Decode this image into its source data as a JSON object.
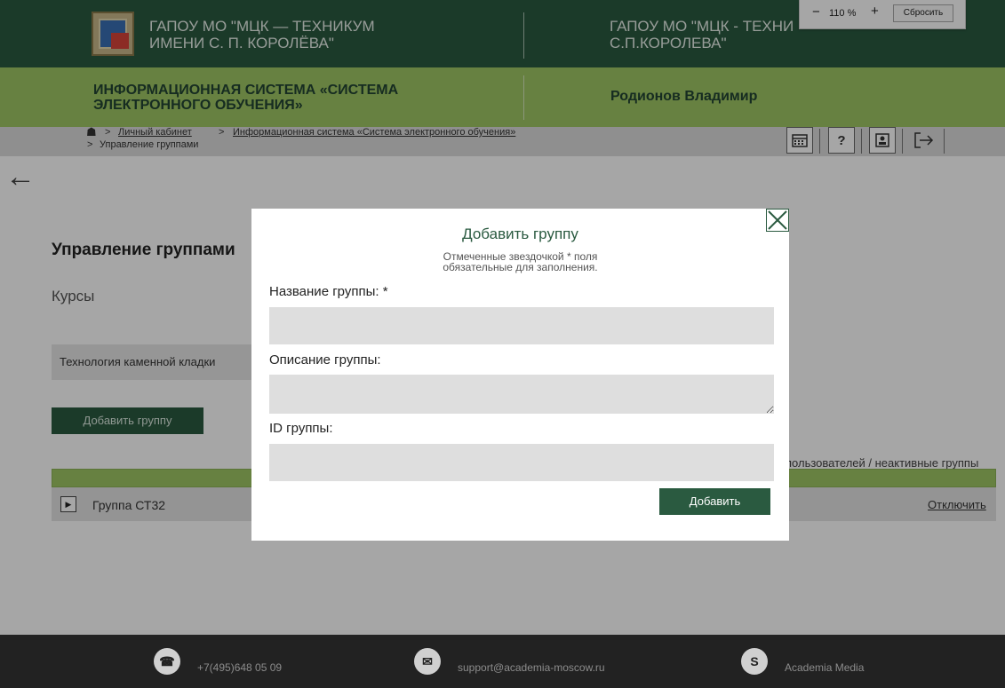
{
  "header": {
    "org_name_line1": "ГАПОУ МО \"МЦК — ТЕХНИКУМ",
    "org_name_line2": "ИМЕНИ С. П. КОРОЛЁВА\"",
    "org_name_alt_line1": "ГАПОУ МО \"МЦК - ТЕХНИ",
    "org_name_alt_line2": "С.П.КОРОЛЕВА\"",
    "system_line1": "ИНФОРМАЦИОННАЯ СИСТЕМА «СИСТЕМА",
    "system_line2": "ЭЛЕКТРОННОГО ОБУЧЕНИЯ»",
    "user_name": "Родионов Владимир"
  },
  "zoom": {
    "minus": "−",
    "value": "110 %",
    "plus": "+",
    "reset": "Сбросить"
  },
  "breadcrumb": {
    "items": [
      "Личный кабинет",
      "Информационная система «Система электронного обучения»",
      "Управление группами"
    ]
  },
  "toolbar": {
    "calendar_icon": "calendar-icon",
    "help_label": "?",
    "profile_icon": "profile-icon",
    "logout_icon": "logout-icon"
  },
  "page": {
    "title": "Управление группами",
    "courses_label": "Курсы",
    "course_selected": "Технология каменной кладки",
    "add_group_button": "Добавить группу",
    "filter_text": "пользователей / неактивные группы",
    "groups": [
      {
        "name": "Группа СТ32",
        "action": "Отключить"
      }
    ]
  },
  "modal": {
    "title": "Добавить группу",
    "note_line1": "Отмеченные звездочкой * поля",
    "note_line2": "обязательные для заполнения.",
    "name_label": "Название группы: *",
    "name_value": "",
    "description_label": "Описание группы:",
    "description_value": "",
    "id_label": "ID группы:",
    "id_value": "",
    "submit": "Добавить"
  },
  "footer": {
    "phone": "+7(495)648 05 09",
    "email": "support@academia-moscow.ru",
    "brand": "Academia Media"
  },
  "colors": {
    "header_green": "#2a5a40",
    "sub_green": "#9fc664",
    "crumb_grey": "#dcdcdc",
    "footer_dark": "#222222"
  }
}
